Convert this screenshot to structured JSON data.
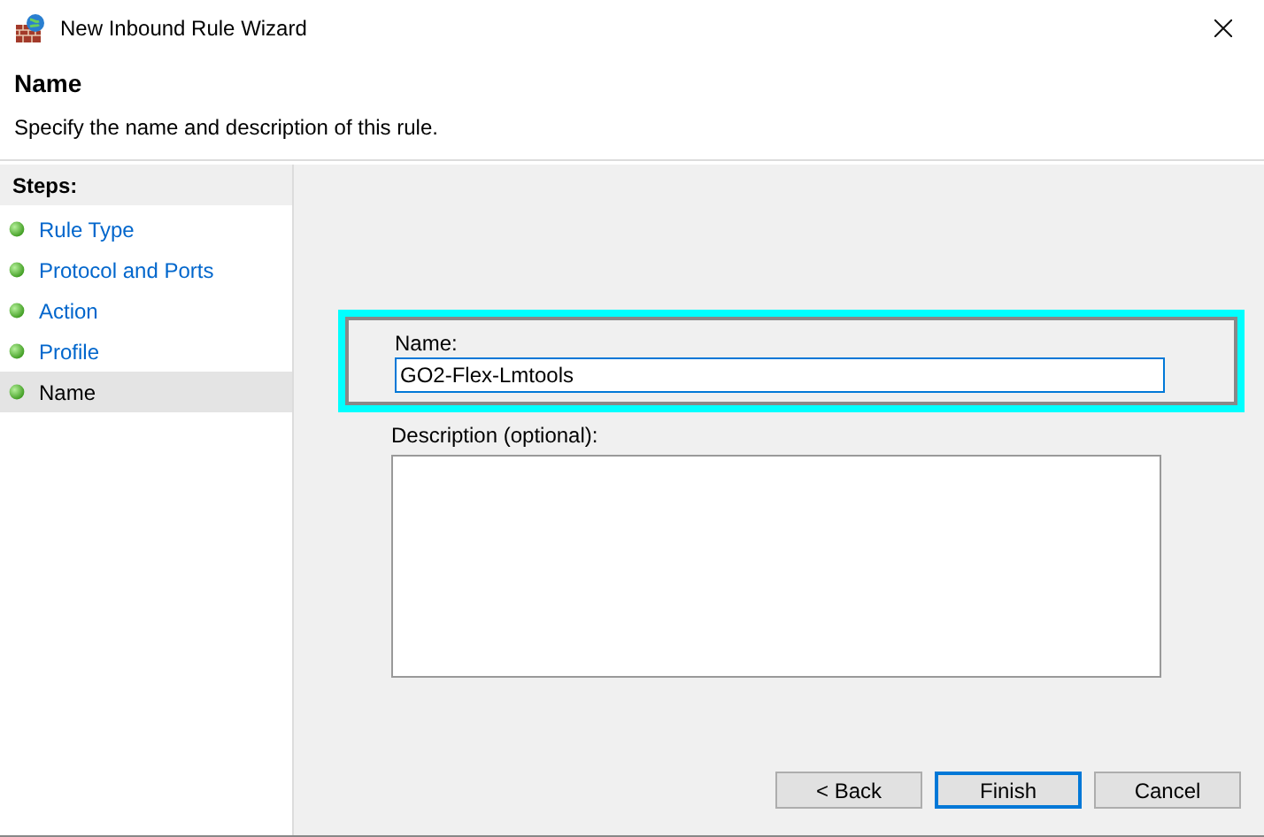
{
  "window": {
    "title": "New Inbound Rule Wizard"
  },
  "header": {
    "title": "Name",
    "subtitle": "Specify the name and description of this rule."
  },
  "steps": {
    "heading": "Steps:",
    "items": [
      {
        "label": "Rule Type",
        "selected": false
      },
      {
        "label": "Protocol and Ports",
        "selected": false
      },
      {
        "label": "Action",
        "selected": false
      },
      {
        "label": "Profile",
        "selected": false
      },
      {
        "label": "Name",
        "selected": true
      }
    ]
  },
  "form": {
    "name_label": "Name:",
    "name_value": "GO2-Flex-Lmtools",
    "highlighted": true,
    "description_label": "Description (optional):"
  },
  "buttons": [
    {
      "label": "< Back",
      "default": false
    },
    {
      "label": "Finish",
      "default": true
    },
    {
      "label": "Cancel",
      "default": false
    }
  ]
}
